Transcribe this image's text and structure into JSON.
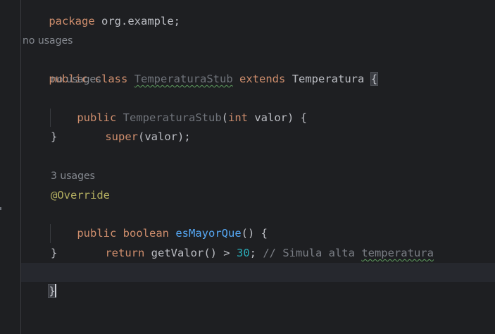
{
  "code": {
    "line_package": {
      "keyword": "package",
      "name": "org.example;"
    },
    "hint_class_usages": "no usages",
    "line_class": {
      "public": "public",
      "class": "class",
      "name": "TemperaturaStub",
      "extends": "extends",
      "parent": "Temperatura",
      "brace": "{"
    },
    "hint_ctor_usages": "no usages",
    "line_ctor": {
      "public": "public",
      "name": "TemperaturaStub",
      "open": "(",
      "type": "int",
      "param": " valor) {"
    },
    "line_super": {
      "super": "super",
      "rest": "(valor);"
    },
    "line_ctor_close": "}",
    "hint_method_usages": "3 usages",
    "line_override": "@Override",
    "line_method": {
      "public": "public",
      "type": "boolean",
      "name": "esMayorQue",
      "rest": "() {"
    },
    "line_return": {
      "return": "return",
      "call": " getValor() > ",
      "number": "30",
      "semicolon": "; ",
      "comment_pre": "// Simula alta ",
      "comment_word": "temperatura"
    },
    "line_method_close": "}",
    "line_class_close": "}"
  }
}
